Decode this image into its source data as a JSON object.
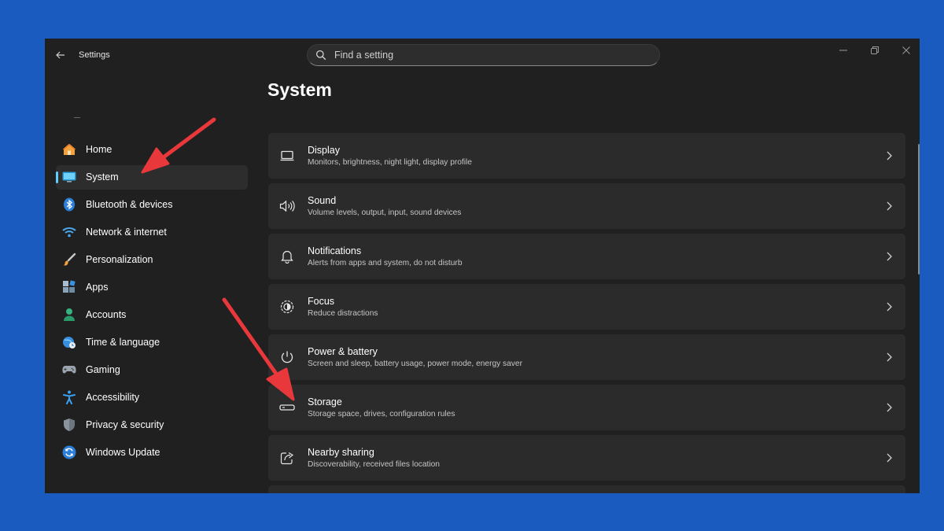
{
  "window": {
    "app_title": "Settings",
    "search": {
      "placeholder": "Find a setting",
      "value": ""
    }
  },
  "sidebar": {
    "items": [
      {
        "label": "Home",
        "icon": "home-icon"
      },
      {
        "label": "System",
        "icon": "system-icon",
        "selected": true
      },
      {
        "label": "Bluetooth & devices",
        "icon": "bluetooth-icon"
      },
      {
        "label": "Network & internet",
        "icon": "wifi-icon"
      },
      {
        "label": "Personalization",
        "icon": "brush-icon"
      },
      {
        "label": "Apps",
        "icon": "apps-icon"
      },
      {
        "label": "Accounts",
        "icon": "person-icon"
      },
      {
        "label": "Time & language",
        "icon": "globe-clock-icon"
      },
      {
        "label": "Gaming",
        "icon": "gamepad-icon"
      },
      {
        "label": "Accessibility",
        "icon": "accessibility-icon"
      },
      {
        "label": "Privacy & security",
        "icon": "shield-icon"
      },
      {
        "label": "Windows Update",
        "icon": "update-icon"
      }
    ]
  },
  "main": {
    "title": "System",
    "cards": [
      {
        "title": "Display",
        "subtitle": "Monitors, brightness, night light, display profile",
        "icon": "display-icon"
      },
      {
        "title": "Sound",
        "subtitle": "Volume levels, output, input, sound devices",
        "icon": "speaker-icon"
      },
      {
        "title": "Notifications",
        "subtitle": "Alerts from apps and system, do not disturb",
        "icon": "bell-icon"
      },
      {
        "title": "Focus",
        "subtitle": "Reduce distractions",
        "icon": "focus-icon"
      },
      {
        "title": "Power & battery",
        "subtitle": "Screen and sleep, battery usage, power mode, energy saver",
        "icon": "power-icon"
      },
      {
        "title": "Storage",
        "subtitle": "Storage space, drives, configuration rules",
        "icon": "storage-icon"
      },
      {
        "title": "Nearby sharing",
        "subtitle": "Discoverability, received files location",
        "icon": "share-icon"
      }
    ]
  },
  "colors": {
    "background": "#1a5bbf",
    "window": "#202020",
    "card": "#2b2b2b",
    "accent": "#60cdff",
    "annotation_arrow": "#e8383b"
  }
}
